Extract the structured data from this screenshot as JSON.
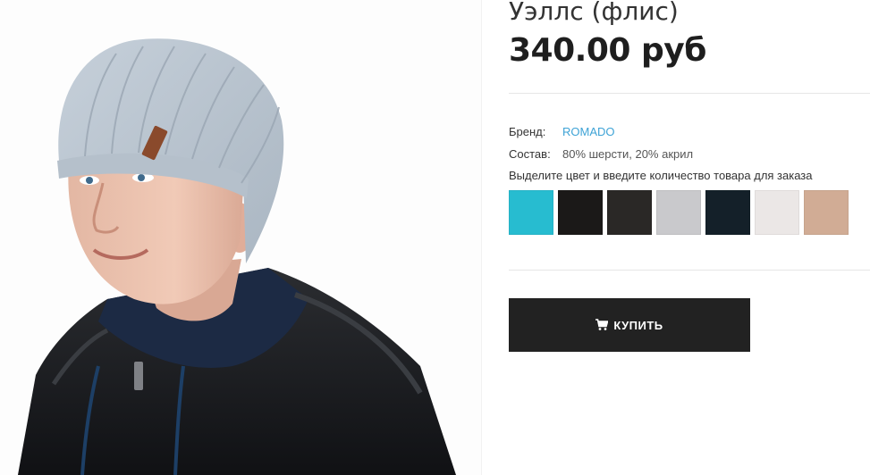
{
  "product": {
    "title": "Уэллс (флис)",
    "price": "340.00 руб"
  },
  "properties": {
    "brand_label": "Бренд:",
    "brand_value": "ROMADO",
    "composition_label": "Состав:",
    "composition_value": "80% шерсти, 20% акрил"
  },
  "color_picker": {
    "instruction": "Выделите цвет и введите количество товара для заказа",
    "colors": [
      "#27bcd0",
      "#1b1918",
      "#2a2826",
      "#c9c9cc",
      "#142029",
      "#ebe7e6",
      "#d1ac95"
    ]
  },
  "actions": {
    "buy_label": "КУПИТЬ",
    "buy_icon": "cart-icon"
  },
  "image": {
    "subject": "product-photo-icon"
  }
}
